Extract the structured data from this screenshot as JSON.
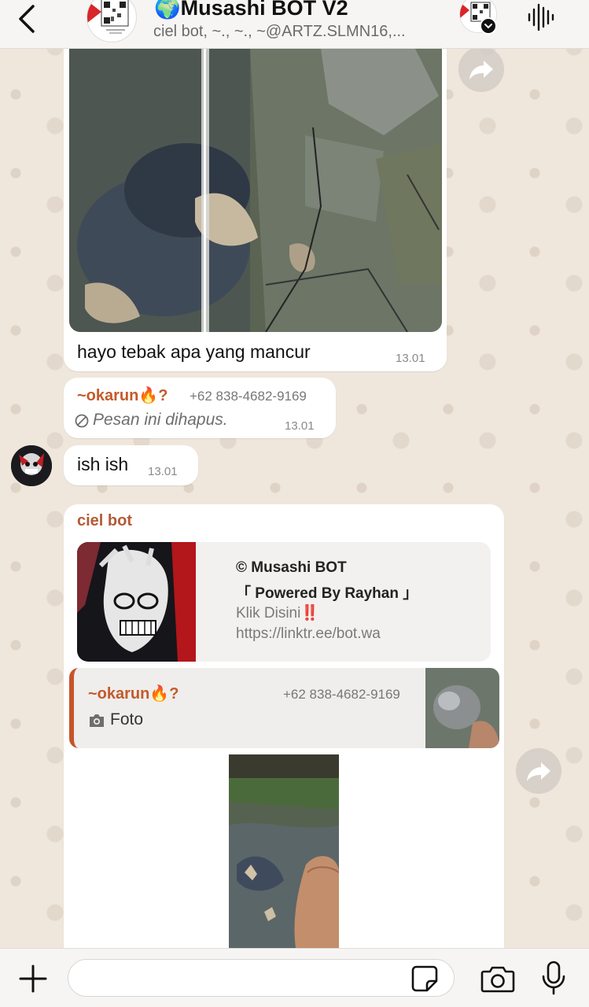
{
  "header": {
    "title": "🌍Musashi BOT V2",
    "subtitle": "ciel bot, ~., ~., ~@ARTZ.SLMN16,..."
  },
  "messages": {
    "msg1": {
      "caption": "hayo tebak apa yang mancur",
      "time": "13.01"
    },
    "msg2": {
      "sender": "~okarun🔥?",
      "phone": "+62 838-4682-9169",
      "text": "Pesan ini dihapus.",
      "time": "13.01"
    },
    "msg3": {
      "text": "ish ish",
      "time": "13.01"
    },
    "msg4": {
      "sender": "ciel bot",
      "preview": {
        "line1": "© Musashi BOT",
        "line2": "「 Powered By Rayhan 」",
        "line3": "Klik Disini‼️",
        "line4": "https://linktr.ee/bot.wa"
      },
      "quote": {
        "sender": "~okarun🔥?",
        "phone": "+62 838-4682-9169",
        "type": "Foto"
      }
    }
  },
  "composer": {
    "value": "",
    "placeholder": ""
  },
  "icons": {
    "back": "chevron-left-icon",
    "voice": "audio-wave-icon",
    "forward": "forward-arrow-icon",
    "blocked": "prohibited-icon",
    "camera_small": "camera-icon",
    "plus": "plus-icon",
    "sticker": "sticker-icon",
    "camera": "camera-icon",
    "mic": "microphone-icon"
  },
  "colors": {
    "sender_accent": "#c35a2a",
    "chat_bg": "#efe6dc",
    "bubble": "#ffffff"
  }
}
